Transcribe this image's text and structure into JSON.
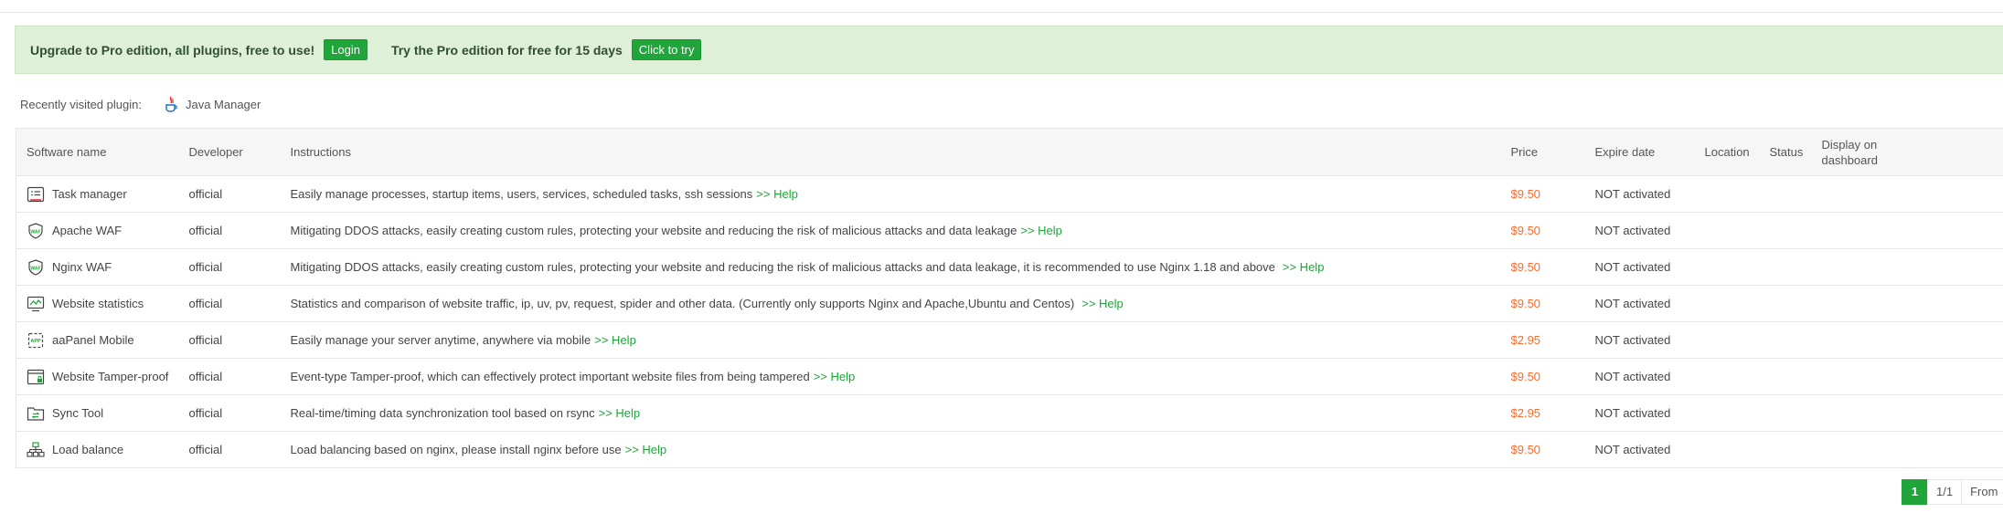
{
  "promo": {
    "upgrade_text": "Upgrade to Pro edition, all plugins, free to use!",
    "login_label": "Login",
    "trial_text": "Try the Pro edition for free for 15 days",
    "try_label": "Click to try"
  },
  "recent": {
    "label": "Recently visited plugin:",
    "plugin": "Java Manager"
  },
  "table": {
    "headers": {
      "name": "Software name",
      "developer": "Developer",
      "instructions": "Instructions",
      "price": "Price",
      "expire": "Expire date",
      "location": "Location",
      "status": "Status",
      "display": "Display on dashboard"
    },
    "help_label": ">> Help",
    "rows": [
      {
        "name": "Task manager",
        "icon": "task-icon",
        "developer": "official",
        "instructions": "Easily manage processes, startup items, users, services, scheduled tasks, ssh sessions",
        "price": "$9.50",
        "expire": "NOT activated"
      },
      {
        "name": "Apache WAF",
        "icon": "shield-waf-icon",
        "developer": "official",
        "instructions": "Mitigating DDOS attacks, easily creating custom rules, protecting your website and reducing the risk of malicious attacks and data leakage",
        "price": "$9.50",
        "expire": "NOT activated"
      },
      {
        "name": "Nginx WAF",
        "icon": "shield-waf-icon",
        "developer": "official",
        "instructions": "Mitigating DDOS attacks, easily creating custom rules, protecting your website and reducing the risk of malicious attacks and data leakage, it is recommended to use Nginx 1.18 and above",
        "price": "$9.50",
        "expire": "NOT activated"
      },
      {
        "name": "Website statistics",
        "icon": "chart-monitor-icon",
        "developer": "official",
        "instructions": "Statistics and comparison of website traffic, ip, uv, pv, request, spider and other data. (Currently only supports Nginx and Apache,Ubuntu and Centos)",
        "price": "$9.50",
        "expire": "NOT activated"
      },
      {
        "name": "aaPanel Mobile",
        "icon": "app-icon",
        "developer": "official",
        "instructions": "Easily manage your server anytime, anywhere via mobile",
        "price": "$2.95",
        "expire": "NOT activated"
      },
      {
        "name": "Website Tamper-proof",
        "icon": "window-lock-icon",
        "developer": "official",
        "instructions": "Event-type Tamper-proof, which can effectively protect important website files from being tampered",
        "price": "$9.50",
        "expire": "NOT activated"
      },
      {
        "name": "Sync Tool",
        "icon": "folder-sync-icon",
        "developer": "official",
        "instructions": "Real-time/timing data synchronization tool based on rsync",
        "price": "$2.95",
        "expire": "NOT activated"
      },
      {
        "name": "Load balance",
        "icon": "network-icon",
        "developer": "official",
        "instructions": "Load balancing based on nginx, please install nginx before use",
        "price": "$9.50",
        "expire": "NOT activated"
      }
    ]
  },
  "pager": {
    "current": "1",
    "total": "1/1",
    "from": "From"
  },
  "colors": {
    "accent": "#20a53a",
    "price": "#ff6a2a",
    "promo_bg": "#dff0d8"
  }
}
